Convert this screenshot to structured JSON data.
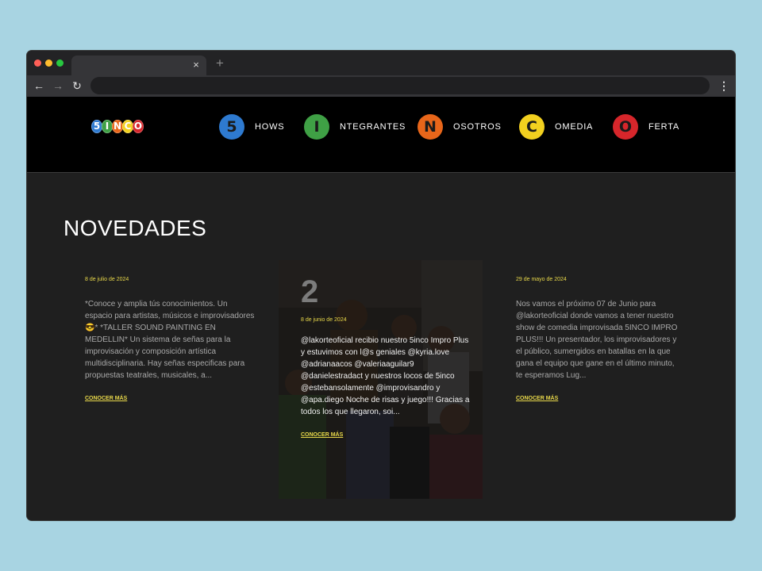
{
  "browser": {
    "tab_close": "×",
    "new_tab": "+",
    "back": "←",
    "forward": "→",
    "reload": "↻",
    "menu": "⋮"
  },
  "logo": {
    "letters": [
      {
        "char": "5",
        "color": "#2e7ad0"
      },
      {
        "char": "I",
        "color": "#3fa045"
      },
      {
        "char": "N",
        "color": "#e8661a"
      },
      {
        "char": "C",
        "color": "#f2d01f"
      },
      {
        "char": "O",
        "color": "#d6262b"
      }
    ]
  },
  "nav": [
    {
      "letter": "5",
      "label": "HOWS",
      "color": "#2e7ad0"
    },
    {
      "letter": "I",
      "label": "NTEGRANTES",
      "color": "#3fa045"
    },
    {
      "letter": "N",
      "label": "OSOTROS",
      "color": "#e8661a"
    },
    {
      "letter": "C",
      "label": "OMEDIA",
      "color": "#f2d01f"
    },
    {
      "letter": "O",
      "label": "FERTA",
      "color": "#d6262b"
    }
  ],
  "section": {
    "title": "NOVEDADES"
  },
  "cards": [
    {
      "date": "8 de julio de 2024",
      "excerpt": "*Conoce y amplia tús conocimientos. Un espacio para artistas, músicos e improvisadores😎* *TALLER SOUND PAINTING EN MEDELLIN* Un sistema de señas para la improvisación y composición artística multidisciplinaria. Hay señas especificas para propuestas teatrales, musicales, a...",
      "link": "CONOCER MÁS"
    },
    {
      "number": "2",
      "date": "8 de junio de 2024",
      "excerpt": "@lakorteoficial recibio nuestro 5inco Impro Plus y estuvimos con l@s geniales @kyria.love @adrianaacos @valeriaaguilar9 @danielestradact y nuestros locos de 5inco @estebansolamente @improvisandro y @apa.diego Noche de risas y juego!!! Gracias a todos los que llegaron, soi...",
      "link": "CONOCER MÁS"
    },
    {
      "date": "29 de mayo de 2024",
      "excerpt": "Nos vamos el próximo 07 de Junio para @lakorteoficial donde vamos a tener nuestro show de comedia improvisada 5INCO IMPRO PLUS!!! Un presentador, los improvisadores y el público, sumergidos en batallas en la que gana el equipo que gane en el último minuto, te esperamos Lug...",
      "link": "CONOCER MÁS"
    }
  ]
}
